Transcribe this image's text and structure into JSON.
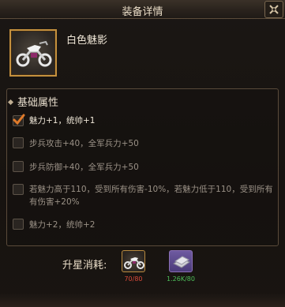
{
  "window": {
    "title": "装备详情"
  },
  "item": {
    "name": "白色魅影",
    "icon": "motorcycle-icon"
  },
  "attributes": {
    "heading": "基础属性",
    "items": [
      {
        "text": "魅力+1，统帅+1",
        "checked": true
      },
      {
        "text": "步兵攻击+40，全军兵力+50",
        "checked": false
      },
      {
        "text": "步兵防御+40，全军兵力+50",
        "checked": false
      },
      {
        "text_line1": "若魅力高于110，受到所有伤害-10%，若魅力低于110，受到所有",
        "text_line2": "有伤害+20%",
        "checked": false
      },
      {
        "text": "魅力+2，统帅+2",
        "checked": false
      }
    ]
  },
  "upgrade": {
    "label": "升星消耗:",
    "materials": [
      {
        "icon": "motorcycle-icon",
        "count": "70/80",
        "color": "#d84a3a"
      },
      {
        "icon": "metal-plate-icon",
        "count": "1.26K/80",
        "color": "#4ec05a"
      }
    ]
  },
  "colors": {
    "accent_gold": "#c5913e",
    "check": "#e07a2a"
  }
}
